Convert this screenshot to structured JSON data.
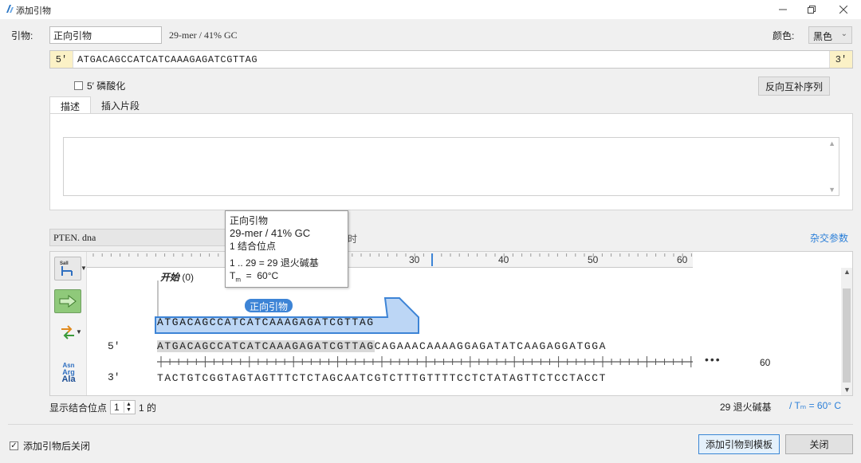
{
  "window": {
    "title": "添加引物"
  },
  "primer": {
    "label": "引物:",
    "name": "正向引物",
    "stats": "29-mer  /  41% GC",
    "color_label": "颜色:",
    "color_value": "黑色",
    "end5": "5′",
    "end3": "3′",
    "sequence": "ATGACAGCCATCATCAAAGAGATCGTTAG",
    "phosphorylate_label": "5′ 磷酸化",
    "revcomp_button": "反向互补序列"
  },
  "tabs": [
    {
      "label": "描述"
    },
    {
      "label": "插入片段"
    }
  ],
  "map": {
    "file": "PTEN. dna",
    "file_tail": "时",
    "hybrid_link": "杂交参数",
    "ruler_ticks": [
      "30",
      "40",
      "50",
      "60"
    ],
    "start_label": "开始",
    "start_pos": "(0)",
    "primer_tag": "正向引物",
    "primer_seq": "ATGACAGCCATCATCAAAGAGATCGTTAG",
    "label5": "5′",
    "label3": "3′",
    "top_seq_match": "ATGACAGCCATCATCAAAGAGATCGTTAG",
    "top_seq_rest": "CAGAAACAAAAGGAGATATCAAGAGGATGGA",
    "bottom_seq": "TACTGTCGGTAGTAGTTTCTCTAGCAATCGTCTTTGTTTTCCTCTATAGTTCTCCTACCT",
    "ellipsis": "•••",
    "end_pos": "60",
    "tool_labels": {
      "restriction": "SalI",
      "aa": [
        "Asn",
        "Arg",
        "Ala"
      ]
    }
  },
  "tooltip": {
    "name": "正向引物",
    "stats": "29-mer  /  41% GC",
    "sites": "1 结合位点",
    "range": "1 .. 29  =  29 退火碱基",
    "tm_prefix": "T",
    "tm_sub": "m",
    "tm_rest": "  =  60°C"
  },
  "bottom": {
    "show_sites_label": "显示结合位点",
    "spin_value": "1",
    "show_sites_suffix": "1 的",
    "anneal": "29 退火碱基",
    "tm": "/ Tₘ = 60° C",
    "close_after_label": "添加引物后关闭",
    "add_button": "添加引物到模板",
    "close_button": "关闭"
  },
  "colors": {
    "accent": "#3d84d6",
    "primer_bar": "#bcd6f5",
    "end_cap": "#fbf1c6"
  }
}
